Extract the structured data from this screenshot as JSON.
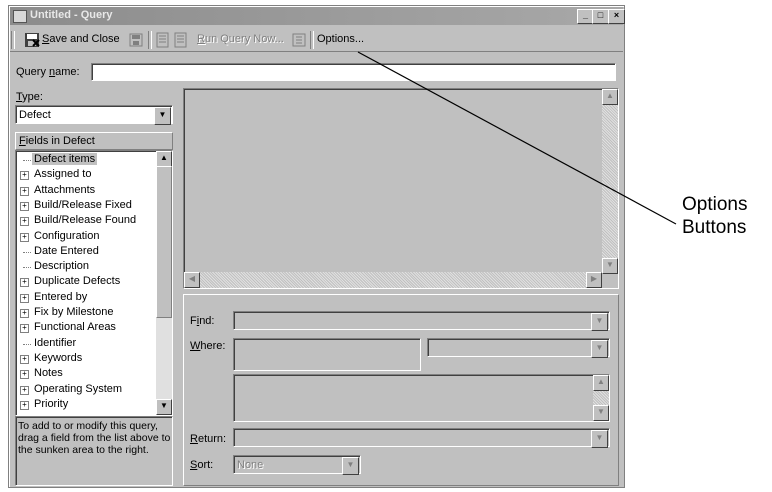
{
  "window": {
    "title": "Untitled - Query",
    "min_glyph": "_",
    "max_glyph": "□",
    "close_glyph": "×"
  },
  "toolbar": {
    "save_close": "Save and Close",
    "run_query": "Run Query Now...",
    "options": "Options..."
  },
  "query_name": {
    "label": "Query name:",
    "value": ""
  },
  "type": {
    "label": "Type:",
    "value": "Defect"
  },
  "fields": {
    "header": "Fields in Defect",
    "items": [
      {
        "label": "Defect items",
        "expandable": false,
        "selected": true
      },
      {
        "label": "Assigned to",
        "expandable": true
      },
      {
        "label": "Attachments",
        "expandable": true
      },
      {
        "label": "Build/Release Fixed",
        "expandable": true
      },
      {
        "label": "Build/Release Found",
        "expandable": true
      },
      {
        "label": "Configuration",
        "expandable": true
      },
      {
        "label": "Date Entered",
        "expandable": false
      },
      {
        "label": "Description",
        "expandable": false
      },
      {
        "label": "Duplicate Defects",
        "expandable": true
      },
      {
        "label": "Entered by",
        "expandable": true
      },
      {
        "label": "Fix by Milestone",
        "expandable": true
      },
      {
        "label": "Functional Areas",
        "expandable": true
      },
      {
        "label": "Identifier",
        "expandable": false
      },
      {
        "label": "Keywords",
        "expandable": true
      },
      {
        "label": "Notes",
        "expandable": true
      },
      {
        "label": "Operating System",
        "expandable": true
      },
      {
        "label": "Priority",
        "expandable": true
      }
    ]
  },
  "help_text": "To add to or modify this query, drag a field from the list above to the sunken area to the right.",
  "criteria": {
    "find_label": "Find:",
    "find_value": "",
    "where_label": "Where:",
    "where_value": "",
    "return_label": "Return:",
    "return_value": "",
    "sort_label": "Sort:",
    "sort_value": "None"
  },
  "annotation": {
    "line1": "Options",
    "line2": "Buttons"
  }
}
